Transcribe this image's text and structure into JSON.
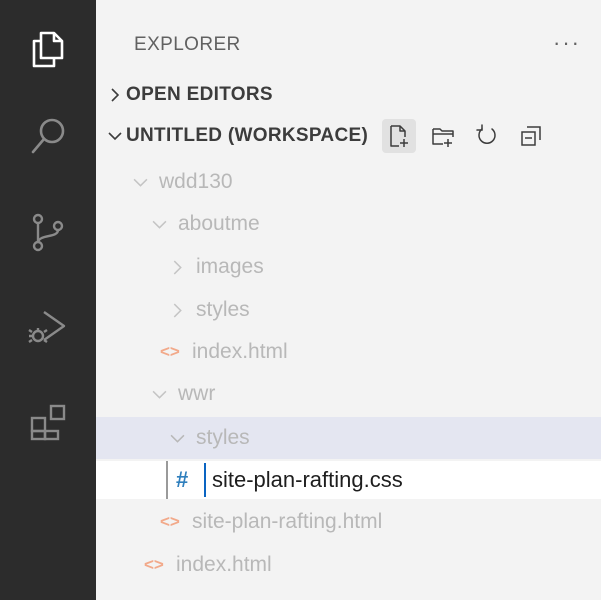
{
  "explorer": {
    "title": "EXPLORER",
    "more": "···"
  },
  "sections": {
    "open_editors": "OPEN EDITORS",
    "workspace": "UNTITLED (WORKSPACE)"
  },
  "workspace_actions": [
    "new-file",
    "new-folder",
    "refresh",
    "collapse-all"
  ],
  "tree": {
    "wdd130": "wdd130",
    "aboutme": "aboutme",
    "images": "images",
    "styles_1": "styles",
    "index_1": "index.html",
    "wwr": "wwr",
    "styles_2": "styles",
    "rename_value": "site-plan-rafting.css",
    "site_plan_html": "site-plan-rafting.html",
    "index_2": "index.html"
  },
  "icons": {
    "html_glyph": "<>",
    "css_glyph": "#"
  },
  "colors": {
    "activity_bar": "#2c2c2c",
    "sidebar": "#f3f3f3",
    "selection": "#e4e6f1",
    "input_cursor": "#0a64c2",
    "css_icon": "#2f7fbd",
    "html_icon": "#f2a98a"
  }
}
